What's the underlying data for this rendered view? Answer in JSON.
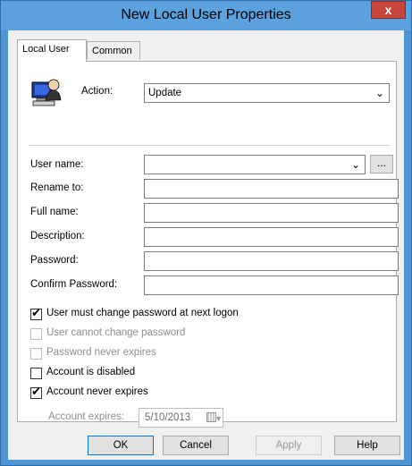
{
  "window": {
    "title": "New Local User Properties",
    "close_glyph": "x"
  },
  "tabs": [
    {
      "label": "Local User",
      "active": true
    },
    {
      "label": "Common",
      "active": false
    }
  ],
  "action": {
    "label": "Action:",
    "value": "Update"
  },
  "fields": {
    "user_name": {
      "label": "User name:",
      "value": ""
    },
    "rename_to": {
      "label": "Rename to:",
      "value": ""
    },
    "full_name": {
      "label": "Full name:",
      "value": ""
    },
    "description": {
      "label": "Description:",
      "value": ""
    },
    "password": {
      "label": "Password:",
      "value": ""
    },
    "confirm_password": {
      "label": "Confirm Password:",
      "value": ""
    }
  },
  "browse_label": "...",
  "checkboxes": [
    {
      "label": "User must change password at next logon",
      "checked": true,
      "enabled": true
    },
    {
      "label": "User cannot change password",
      "checked": false,
      "enabled": false
    },
    {
      "label": "Password never expires",
      "checked": false,
      "enabled": false
    },
    {
      "label": "Account is disabled",
      "checked": false,
      "enabled": true
    },
    {
      "label": "Account never expires",
      "checked": true,
      "enabled": true
    }
  ],
  "account_expires": {
    "label": "Account expires:",
    "value": "5/10/2013",
    "enabled": false
  },
  "buttons": {
    "ok": "OK",
    "cancel": "Cancel",
    "apply": "Apply",
    "help": "Help"
  },
  "icons": {
    "user": "user-computer-icon",
    "dropdown": "chevron-down-icon",
    "calendar": "calendar-icon"
  },
  "colors": {
    "titlebar": "#5aa1de",
    "close": "#c7453b",
    "frame": "#4f95d3"
  }
}
